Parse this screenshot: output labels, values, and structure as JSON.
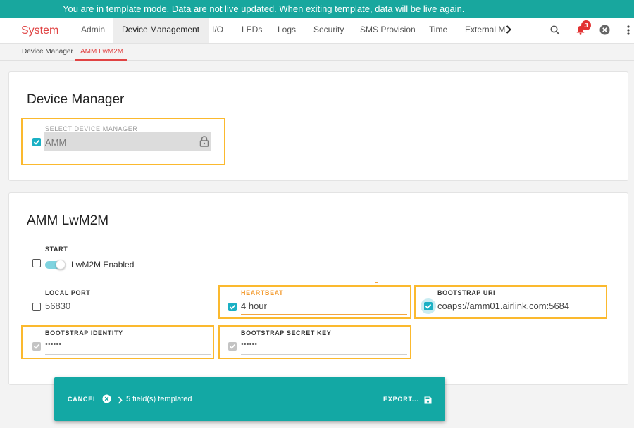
{
  "banner": {
    "text": "You are in template mode. Data are not live updated. When exiting template, data will be live again."
  },
  "header": {
    "brand": "System",
    "tabs": [
      "Admin",
      "Device Management",
      "I/O",
      "LEDs",
      "Logs",
      "Security",
      "SMS Provision",
      "Time",
      "External Mo"
    ],
    "active_tab": "Device Management",
    "notification_count": "3",
    "icons": [
      "search-icon",
      "bell-icon",
      "close-circle-icon",
      "more-vert-icon",
      "chevron-right-icon"
    ]
  },
  "subnav": {
    "tabs": [
      "Device Manager",
      "AMM LwM2M"
    ],
    "active": "AMM LwM2M"
  },
  "device_manager": {
    "title": "Device Manager",
    "select_label": "SELECT DEVICE MANAGER",
    "select_value": "AMM",
    "templated": true
  },
  "amm": {
    "title": "AMM LwM2M",
    "start_label": "START",
    "toggle_label": "LwM2M Enabled",
    "toggle_on": true,
    "local_port_label": "LOCAL PORT",
    "local_port_value": "56830",
    "heartbeat_label": "HEARTBEAT",
    "heartbeat_value": "4 hour",
    "bootstrap_uri_label": "BOOTSTRAP URI",
    "bootstrap_uri_value": "coaps://amm01.airlink.com:5684",
    "bootstrap_identity_label": "BOOTSTRAP IDENTITY",
    "bootstrap_identity_value": "••••••",
    "bootstrap_secret_label": "BOOTSTRAP SECRET KEY",
    "bootstrap_secret_value": "••••••"
  },
  "snackbar": {
    "cancel_label": "CANCEL",
    "message": "5 field(s) templated",
    "export_label": "EXPORT..."
  },
  "colors": {
    "accent": "#18a79e",
    "brand": "#e04343",
    "highlight": "#fbb92e",
    "checkbox": "#1ab0c4"
  }
}
